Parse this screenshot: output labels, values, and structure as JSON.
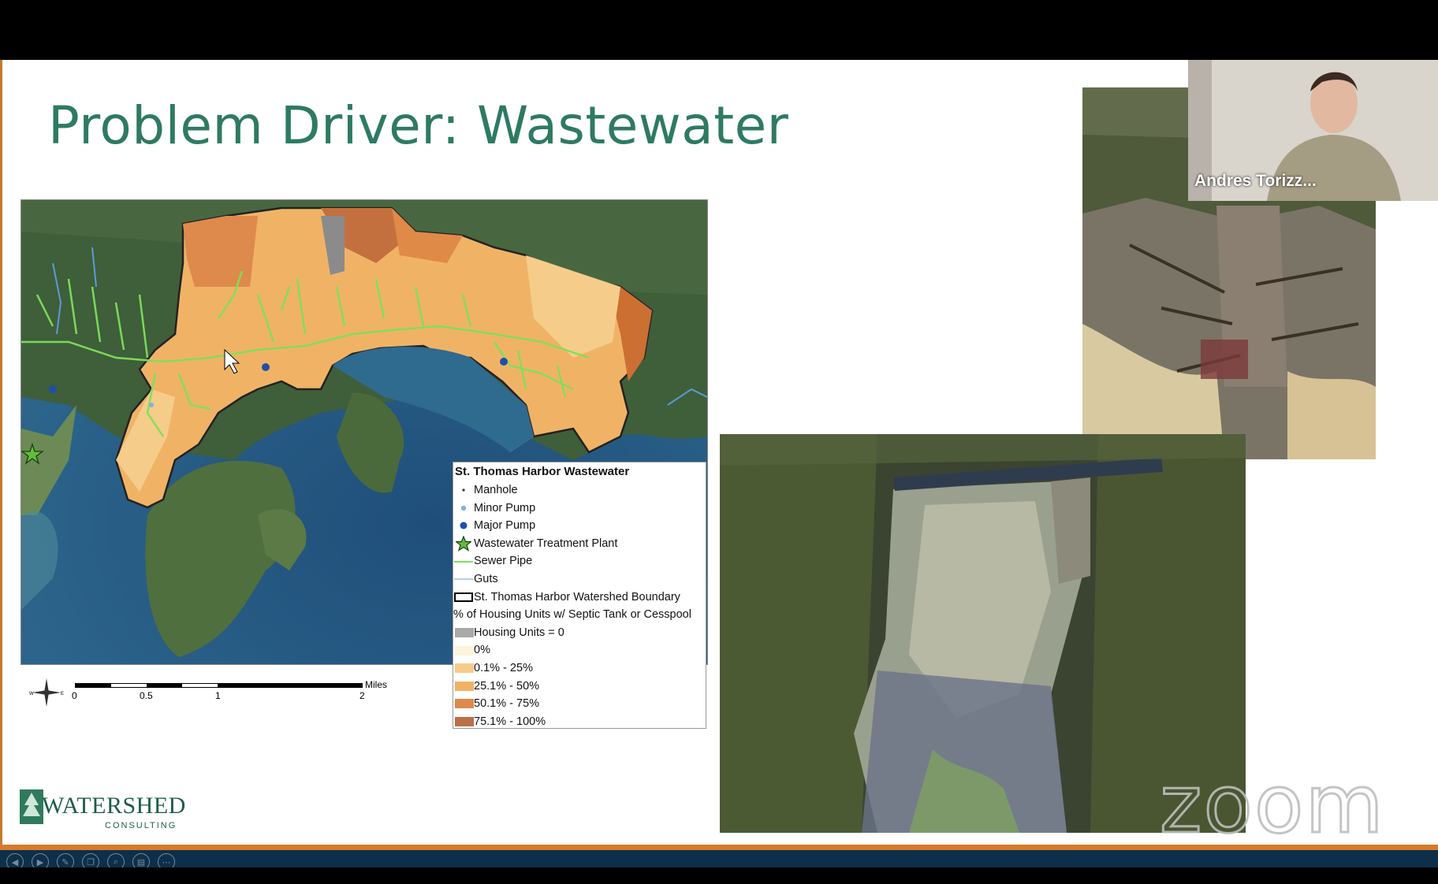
{
  "slide": {
    "title": "Problem Driver: Wastewater",
    "logo": {
      "main": "WATERSHED",
      "sub": "CONSULTING"
    }
  },
  "map": {
    "legend": {
      "title": "St. Thomas Harbor Wastewater",
      "items": [
        {
          "label": "Manhole",
          "symbol": "small-dot-icon"
        },
        {
          "label": "Minor Pump",
          "symbol": "light-blue-dot-icon"
        },
        {
          "label": "Major Pump",
          "symbol": "dark-blue-dot-icon"
        },
        {
          "label": "Wastewater Treatment Plant",
          "symbol": "green-star-icon"
        },
        {
          "label": "Sewer Pipe",
          "symbol": "green-line-icon"
        },
        {
          "label": "Guts",
          "symbol": "blue-line-icon"
        },
        {
          "label": "St. Thomas Harbor Watershed Boundary",
          "symbol": "black-outline-box-icon"
        }
      ],
      "subheading": "% of Housing Units w/ Septic Tank or Cesspool",
      "classes": [
        {
          "label": "Housing Units = 0",
          "color": "#a9a9a9"
        },
        {
          "label": "0%",
          "color": "#fdf4dc"
        },
        {
          "label": "0.1% - 25%",
          "color": "#f6cc8a"
        },
        {
          "label": "25.1% - 50%",
          "color": "#f0b366"
        },
        {
          "label": "50.1% - 75%",
          "color": "#de8a4c"
        },
        {
          "label": "75.1% - 100%",
          "color": "#bb6f49"
        }
      ]
    },
    "scale": {
      "unit": "Miles",
      "ticks": [
        "0",
        "0.5",
        "1",
        "2"
      ]
    }
  },
  "video": {
    "participant_name": "Andres Torizz..."
  },
  "watermark": {
    "text": "zoom"
  },
  "controls": [
    {
      "icon": "previous-slide-icon",
      "glyph": "◀"
    },
    {
      "icon": "next-slide-icon",
      "glyph": "▶"
    },
    {
      "icon": "pen-icon",
      "glyph": "✎"
    },
    {
      "icon": "copy-slides-icon",
      "glyph": "❐"
    },
    {
      "icon": "zoom-icon",
      "glyph": "⌕"
    },
    {
      "icon": "subtitles-icon",
      "glyph": "▤"
    },
    {
      "icon": "more-options-icon",
      "glyph": "⋯"
    }
  ],
  "colors": {
    "title": "#2e7a63",
    "accent_rule": "#d87a2a",
    "sewer_pipe": "#7ee05a"
  }
}
